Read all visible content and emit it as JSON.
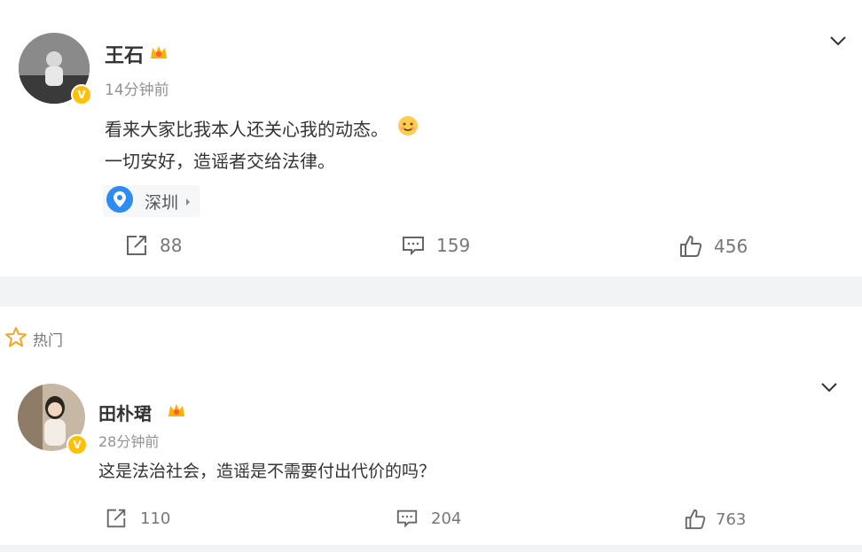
{
  "post": {
    "author": "王石",
    "time": "14分钟前",
    "line1": "看来大家比我本人还关心我的动态。",
    "line2": "一切安好，造谣者交给法律。",
    "location": "深圳",
    "reposts": "88",
    "comments": "159",
    "likes": "456"
  },
  "section": {
    "label": "热门"
  },
  "comment": {
    "author": "田朴珺",
    "time": "28分钟前",
    "text": "这是法治社会，造谣是不需要付出代价的吗？",
    "reposts": "110",
    "comments": "204",
    "likes": "763"
  },
  "icons": {
    "verified": "V",
    "colors": {
      "verified": "#ffc107",
      "location": "#2d8cf0",
      "star": "#f5a623"
    }
  }
}
